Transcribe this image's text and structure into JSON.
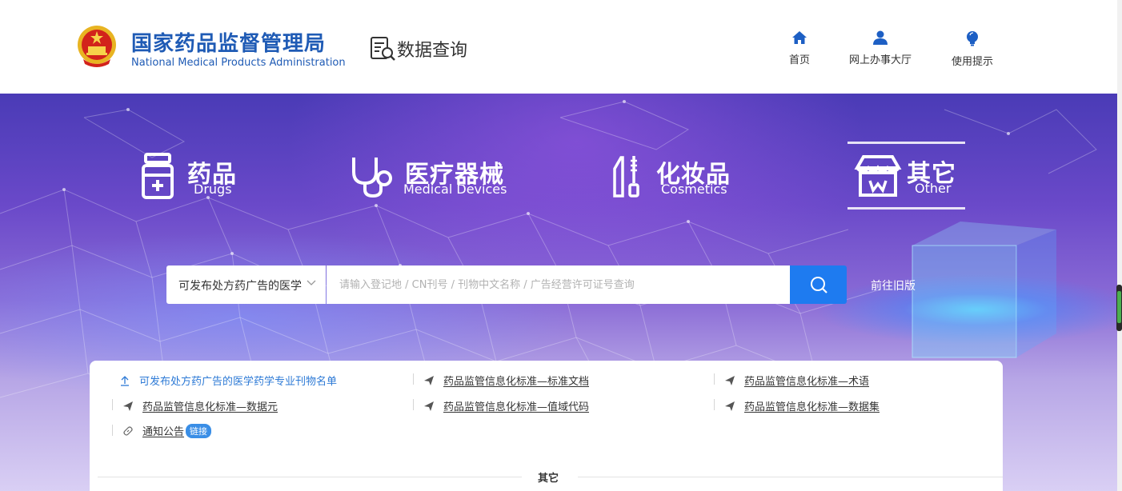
{
  "header": {
    "org_cn": "国家药品监督管理局",
    "org_en": "National Medical Products Administration",
    "section": "数据查询",
    "nav": [
      {
        "label": "首页",
        "icon": "home-icon"
      },
      {
        "label": "网上办事大厅",
        "icon": "user-icon"
      },
      {
        "label": "使用提示",
        "icon": "lightbulb-icon"
      }
    ]
  },
  "categories": [
    {
      "cn": "药品",
      "en": "Drugs",
      "icon": "medicine-bottle-icon"
    },
    {
      "cn": "医疗器械",
      "en": "Medical Devices",
      "icon": "stethoscope-icon"
    },
    {
      "cn": "化妆品",
      "en": "Cosmetics",
      "icon": "cosmetics-icon"
    },
    {
      "cn": "其它",
      "en": "Other",
      "icon": "store-icon",
      "selected": true
    }
  ],
  "search": {
    "selected_option": "可发布处方药广告的医学",
    "placeholder": "请输入登记地 / CN刊号 / 刊物中文名称 / 广告经营许可证号查询",
    "button_icon": "search-icon",
    "old_version_link": "前往旧版"
  },
  "links": [
    {
      "text": "可发布处方药广告的医学药学专业刊物名单",
      "icon": "upload-icon",
      "active": true
    },
    {
      "text": "药品监管信息化标准—标准文档",
      "icon": "send-icon"
    },
    {
      "text": "药品监管信息化标准—术语",
      "icon": "send-icon"
    },
    {
      "text": "药品监管信息化标准—数据元",
      "icon": "send-icon"
    },
    {
      "text": "药品监管信息化标准—值域代码",
      "icon": "send-icon"
    },
    {
      "text": "药品监管信息化标准—数据集",
      "icon": "send-icon"
    },
    {
      "text": "通知公告",
      "icon": "link-icon",
      "badge": "链接"
    }
  ],
  "section_title": "其它",
  "colors": {
    "brand_blue": "#1f5bb5",
    "search_button": "#1e7bf0",
    "link_active": "#2d7ad6",
    "badge": "#3a8ee6"
  }
}
